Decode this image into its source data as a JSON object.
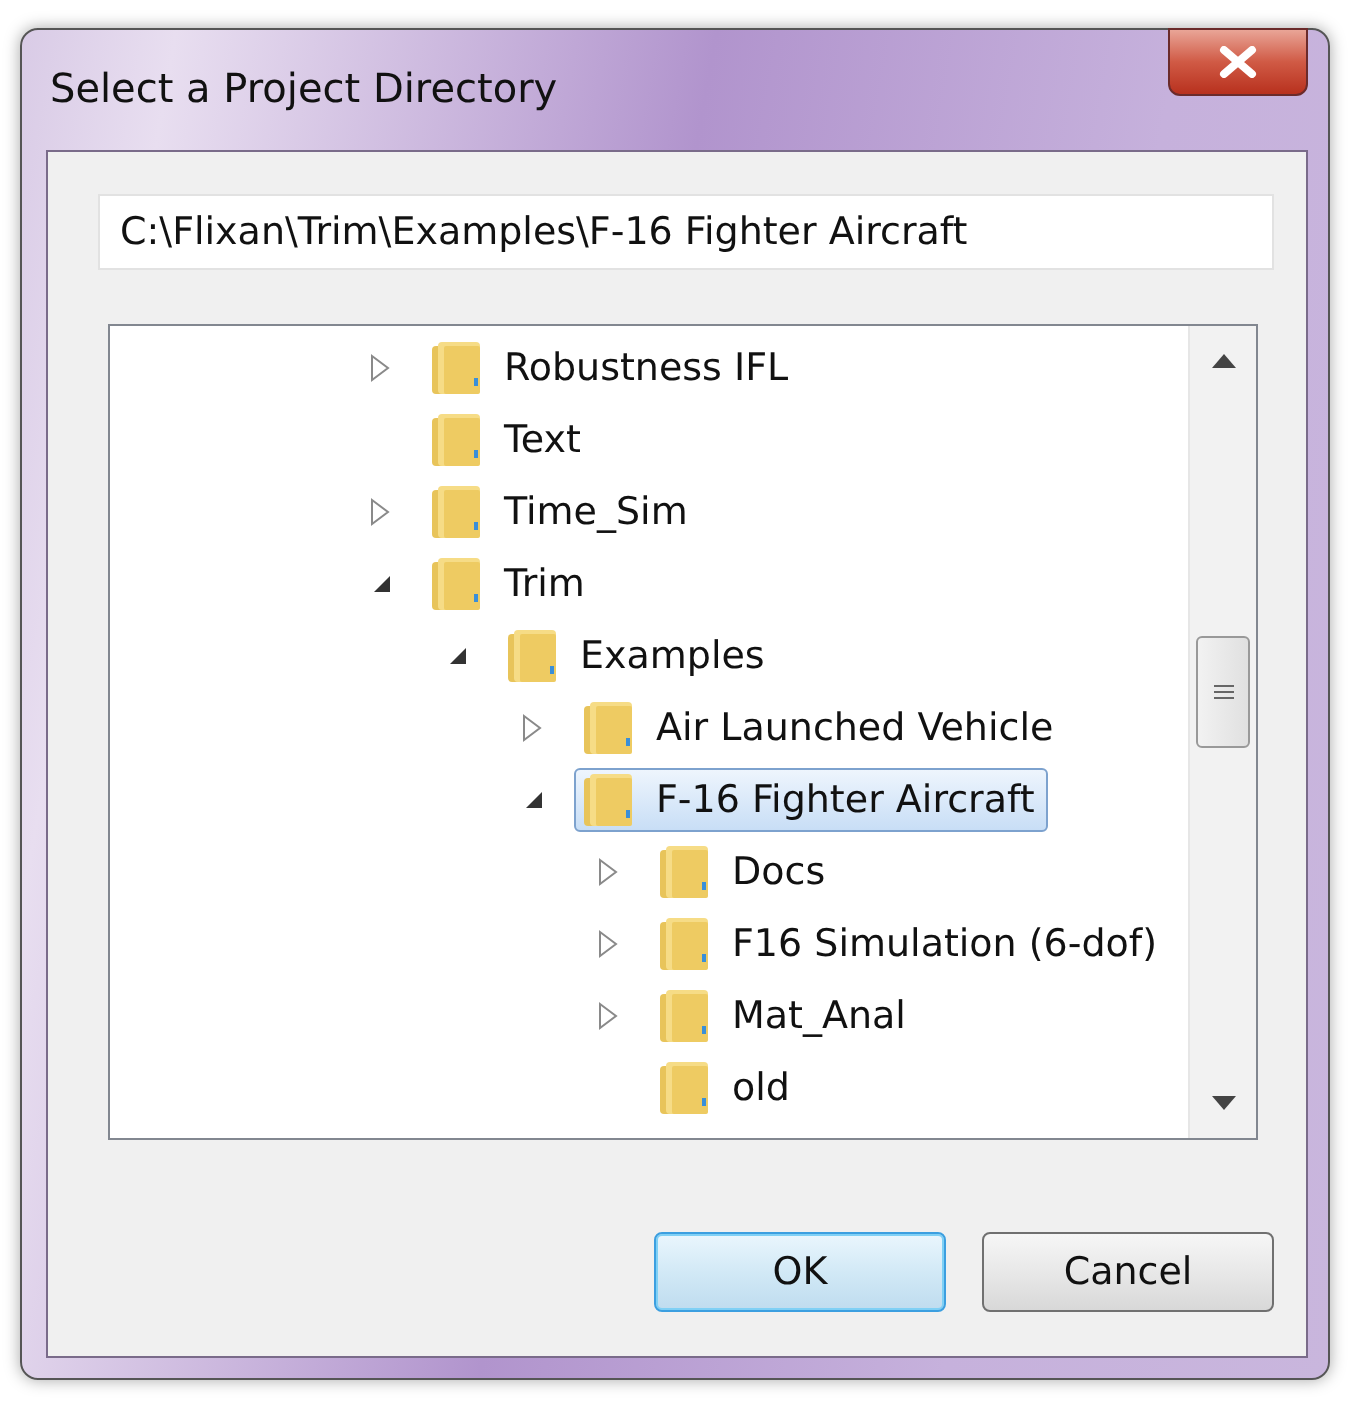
{
  "window": {
    "title": "Select a Project Directory"
  },
  "path_field": {
    "value": "C:\\Flixan\\Trim\\Examples\\F-16 Fighter Aircraft"
  },
  "tree": [
    {
      "label": "Robustness IFL",
      "expandable": true,
      "expanded": false,
      "selected": false
    },
    {
      "label": "Text",
      "expandable": false,
      "selected": false
    },
    {
      "label": "Time_Sim",
      "expandable": true,
      "expanded": false,
      "selected": false
    },
    {
      "label": "Trim",
      "expandable": true,
      "expanded": true,
      "selected": false,
      "children": [
        {
          "label": "Examples",
          "expandable": true,
          "expanded": true,
          "selected": false,
          "children": [
            {
              "label": "Air Launched Vehicle",
              "expandable": true,
              "expanded": false,
              "selected": false
            },
            {
              "label": "F-16 Fighter Aircraft",
              "expandable": true,
              "expanded": true,
              "selected": true,
              "children": [
                {
                  "label": "Docs",
                  "expandable": true,
                  "expanded": false,
                  "selected": false
                },
                {
                  "label": "F16 Simulation (6-dof)",
                  "expandable": true,
                  "expanded": false,
                  "selected": false
                },
                {
                  "label": "Mat_Anal",
                  "expandable": true,
                  "expanded": false,
                  "selected": false
                },
                {
                  "label": "old",
                  "expandable": false,
                  "selected": false
                }
              ]
            }
          ]
        }
      ]
    }
  ],
  "buttons": [
    {
      "label": "OK",
      "default": true
    },
    {
      "label": "Cancel",
      "default": false
    }
  ]
}
